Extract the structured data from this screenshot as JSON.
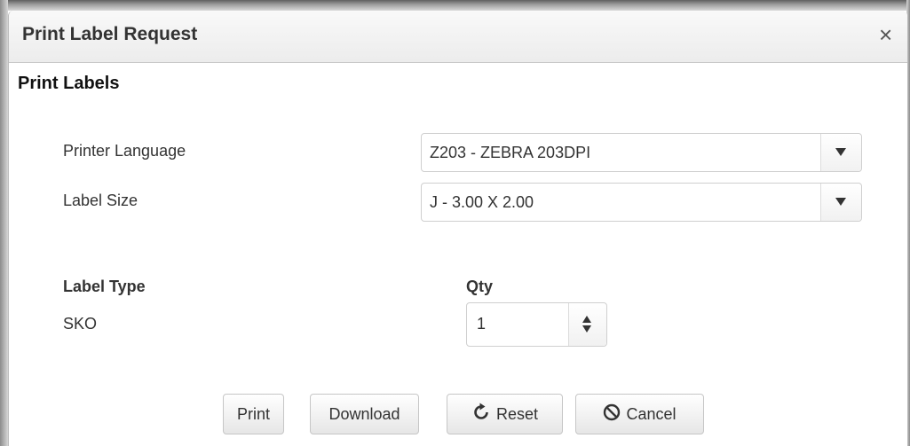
{
  "dialog": {
    "title": "Print Label Request",
    "close_glyph": "×"
  },
  "form": {
    "section_title": "Print Labels",
    "printer_language": {
      "label": "Printer Language",
      "selected": "Z203 - ZEBRA 203DPI"
    },
    "label_size": {
      "label": "Label Size",
      "selected": "J - 3.00 X 2.00"
    },
    "label_type_header": "Label Type",
    "label_type_value": "SKO",
    "qty_header": "Qty",
    "qty_value": "1"
  },
  "buttons": {
    "print": "Print",
    "download": "Download",
    "reset": "Reset",
    "cancel": "Cancel"
  },
  "icons": {
    "close": "close-icon",
    "dropdown": "chevron-down-icon",
    "spinner": "spinner-arrows-icon",
    "reset": "refresh-icon",
    "cancel": "ban-icon"
  }
}
